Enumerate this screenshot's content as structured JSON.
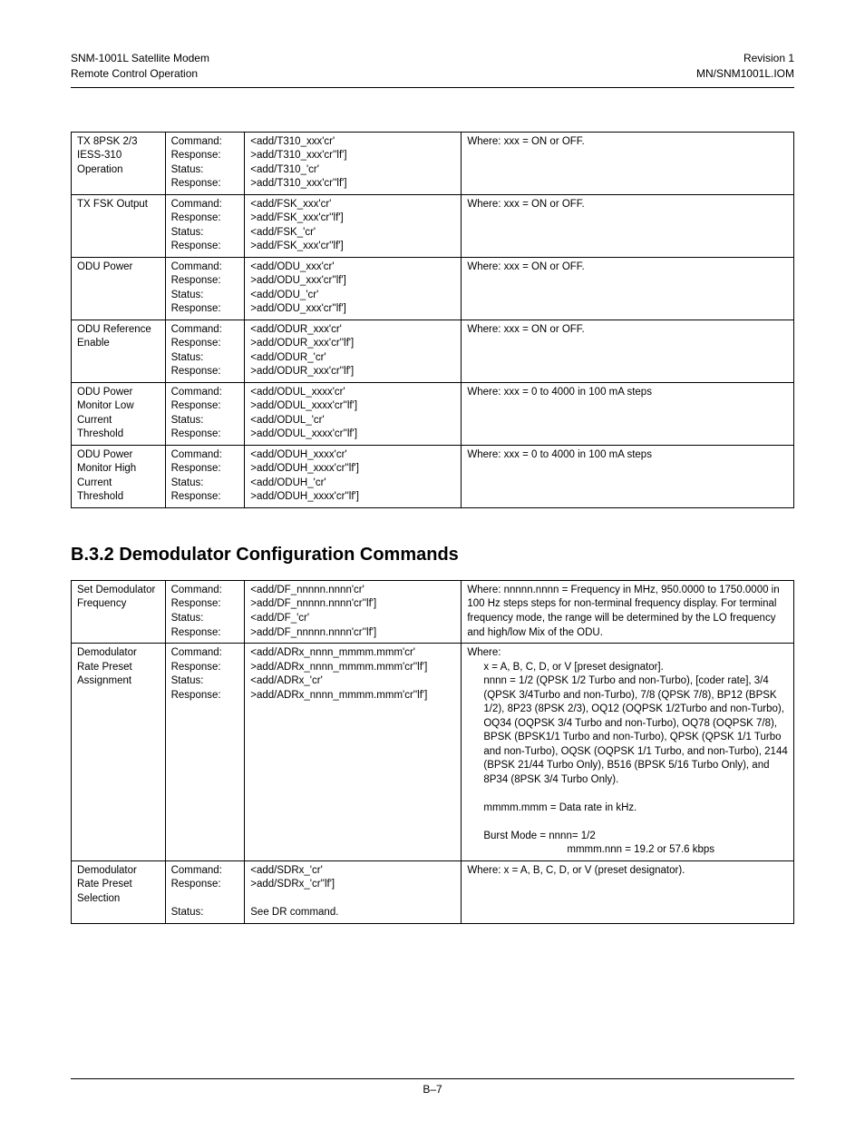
{
  "header": {
    "left1": "SNM-1001L Satellite Modem",
    "left2": "Remote Control Operation",
    "right1": "Revision 1",
    "right2": "MN/SNM1001L.IOM"
  },
  "footer": {
    "page": "B–7"
  },
  "section_heading": "B.3.2 Demodulator Configuration Commands",
  "labels": {
    "command": "Command:",
    "response": "Response:",
    "status": "Status:"
  },
  "table1": [
    {
      "name": "TX 8PSK 2/3\nIESS-310 Operation",
      "c1": "<add/T310_xxx'cr'",
      "r1": ">add/T310_xxx'cr''lf']",
      "c2": "<add/T310_'cr'",
      "r2": ">add/T310_xxx'cr''lf']",
      "where": "Where: xxx = ON or OFF."
    },
    {
      "name": "TX FSK Output",
      "c1": "<add/FSK_xxx'cr'",
      "r1": ">add/FSK_xxx'cr''lf']",
      "c2": "<add/FSK_'cr'",
      "r2": ">add/FSK_xxx'cr''lf']",
      "where": "Where: xxx = ON or OFF."
    },
    {
      "name": "ODU Power",
      "c1": "<add/ODU_xxx'cr'",
      "r1": ">add/ODU_xxx'cr''lf']",
      "c2": "<add/ODU_'cr'",
      "r2": ">add/ODU_xxx'cr''lf']",
      "where": "Where: xxx = ON or OFF."
    },
    {
      "name": "ODU Reference Enable",
      "c1": "<add/ODUR_xxx'cr'",
      "r1": ">add/ODUR_xxx'cr''lf']",
      "c2": "<add/ODUR_'cr'",
      "r2": ">add/ODUR_xxx'cr''lf']",
      "where": "Where: xxx = ON or OFF."
    },
    {
      "name": "ODU Power Monitor Low Current Threshold\n",
      "c1": "<add/ODUL_xxxx'cr'",
      "r1": ">add/ODUL_xxxx'cr''lf']",
      "c2": "<add/ODUL_'cr'",
      "r2": ">add/ODUL_xxxx'cr''lf']",
      "where": "Where: xxx =  0 to 4000 in 100 mA steps"
    },
    {
      "name": "ODU Power Monitor High Current Threshold\n",
      "c1": "<add/ODUH_xxxx'cr'",
      "r1": ">add/ODUH_xxxx'cr''lf']",
      "c2": "<add/ODUH_'cr'",
      "r2": ">add/ODUH_xxxx'cr''lf']",
      "where": "Where: xxx =  0 to 4000 in 100 mA steps"
    }
  ],
  "table2": [
    {
      "name": "Set Demodulator Frequency",
      "types": "Command:\nResponse:\nStatus:\nResponse:",
      "syntax": "<add/DF_nnnnn.nnnn'cr'\n>add/DF_nnnnn.nnnn'cr''lf']\n<add/DF_'cr'\n>add/DF_nnnnn.nnnn'cr''lf']",
      "where_plain": "Where: nnnnn.nnnn = Frequency in MHz, 950.0000 to 1750.0000 in 100 Hz steps steps for non-terminal frequency display. For terminal frequency mode, the range will be determined by the LO frequency and high/low Mix of the ODU.\n"
    },
    {
      "name": "Demodulator Rate Preset Assignment",
      "types": "Command:\nResponse:\nStatus:\nResponse:",
      "syntax": "<add/ADRx_nnnn_mmmm.mmm'cr'\n>add/ADRx_nnnn_mmmm.mmm'cr''lf']\n<add/ADRx_'cr'\n>add/ADRx_nnnn_mmmm.mmm'cr''lf']",
      "where_head": "Where:",
      "where_body": "x = A, B, C, D, or V [preset designator].\nnnnn = 1/2 (QPSK 1/2 Turbo and non-Turbo), [coder rate], 3/4  (QPSK 3/4Turbo and non-Turbo), 7/8 (QPSK 7/8), BP12 (BPSK 1/2), 8P23 (8PSK 2/3), OQ12 (OQPSK 1/2Turbo and non-Turbo), OQ34 (OQPSK 3/4 Turbo and non-Turbo), OQ78 (OQPSK 7/8), BPSK (BPSK1/1 Turbo and non-Turbo), QPSK (QPSK 1/1 Turbo and non-Turbo), OQSK (OQPSK 1/1 Turbo, and non-Turbo),  2144 (BPSK 21/44 Turbo Only), B516 (BPSK 5/16 Turbo Only), and 8P34 (8PSK 3/4 Turbo Only).\n\nmmmm.mmm = Data rate in kHz.\n\nBurst Mode = nnnn= 1/2",
      "where_tail": "mmmm.nnn = 19.2 or 57.6 kbps\n"
    },
    {
      "name": "Demodulator Rate Preset Selection",
      "types": "Command:\nResponse:\n\nStatus:",
      "syntax": "<add/SDRx_'cr'\n>add/SDRx_'cr''lf']\n\nSee DR command.",
      "where_plain": "Where: x = A, B, C, D, or V (preset designator)."
    }
  ]
}
